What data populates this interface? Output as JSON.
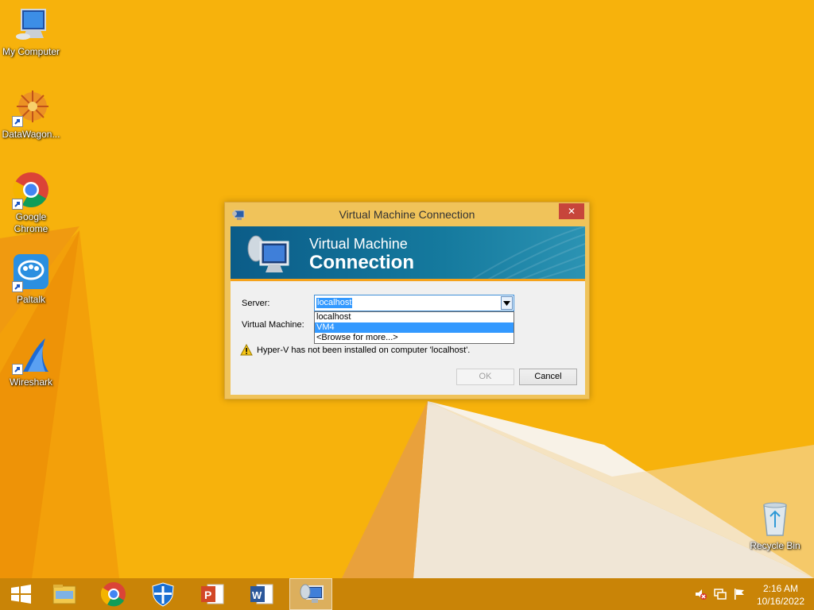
{
  "desktop": {
    "icons": [
      {
        "label": "My Computer"
      },
      {
        "label": "DataWagon..."
      },
      {
        "label": "Google Chrome"
      },
      {
        "label": "Paltalk"
      },
      {
        "label": "Wireshark"
      },
      {
        "label": "Recycle Bin"
      }
    ]
  },
  "dialog": {
    "title": "Virtual Machine Connection",
    "close_label": "✕",
    "banner_line1": "Virtual Machine",
    "banner_line2": "Connection",
    "server_label": "Server:",
    "server_value": "localhost",
    "vm_label": "Virtual Machine:",
    "server_options": [
      "localhost",
      "VM4",
      "<Browse for more...>"
    ],
    "selected_option": "VM4",
    "warning": "Hyper-V has not been installed on computer 'localhost'.",
    "ok_label": "OK",
    "cancel_label": "Cancel"
  },
  "taskbar": {
    "items": [
      "start-icon",
      "file-explorer-icon",
      "chrome-icon",
      "defender-icon",
      "powerpoint-icon",
      "word-icon",
      "vmconnect-icon"
    ],
    "clock_time": "2:16 AM",
    "clock_date": "10/16/2022"
  },
  "colors": {
    "desktop_bg": "#f7b20c",
    "dialog_frame": "#f0c35a",
    "banner": "#157a9e",
    "selection": "#3399ff",
    "taskbar": "#c98407"
  }
}
